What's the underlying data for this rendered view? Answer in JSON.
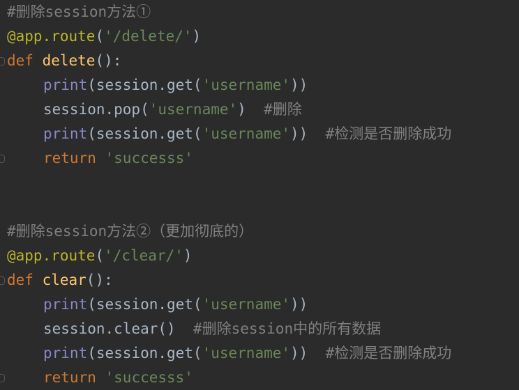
{
  "editor": {
    "background": "#2b2b2b",
    "colors": {
      "comment": "#808080",
      "decorator": "#bbb529",
      "keyword": "#cc7832",
      "function_name": "#ffc66d",
      "builtin": "#8888c6",
      "string": "#6a8759",
      "default": "#a9b7c6"
    },
    "lines": [
      {
        "indent": 0,
        "tokens": [
          {
            "type": "comment",
            "text": "#删除session方法①"
          }
        ]
      },
      {
        "indent": 0,
        "tokens": [
          {
            "type": "decorator",
            "text": "@app.route"
          },
          {
            "type": "default",
            "text": "("
          },
          {
            "type": "string",
            "text": "'/delete/'"
          },
          {
            "type": "default",
            "text": ")"
          }
        ]
      },
      {
        "indent": 0,
        "fold": true,
        "tokens": [
          {
            "type": "keyword",
            "text": "def "
          },
          {
            "type": "funcname",
            "text": "delete"
          },
          {
            "type": "default",
            "text": "():"
          }
        ]
      },
      {
        "indent": 1,
        "tokens": [
          {
            "type": "builtin",
            "text": "print"
          },
          {
            "type": "default",
            "text": "(session.get("
          },
          {
            "type": "string",
            "text": "'username'"
          },
          {
            "type": "default",
            "text": "))"
          }
        ]
      },
      {
        "indent": 1,
        "tokens": [
          {
            "type": "default",
            "text": "session.pop("
          },
          {
            "type": "string",
            "text": "'username'"
          },
          {
            "type": "default",
            "text": ")  "
          },
          {
            "type": "comment",
            "text": "#删除"
          }
        ]
      },
      {
        "indent": 1,
        "tokens": [
          {
            "type": "builtin",
            "text": "print"
          },
          {
            "type": "default",
            "text": "(session.get("
          },
          {
            "type": "string",
            "text": "'username'"
          },
          {
            "type": "default",
            "text": "))  "
          },
          {
            "type": "comment",
            "text": "#检测是否删除成功"
          }
        ]
      },
      {
        "indent": 1,
        "fold": true,
        "tokens": [
          {
            "type": "keyword",
            "text": "return "
          },
          {
            "type": "string",
            "text": "'successs'"
          }
        ]
      },
      {
        "indent": 0,
        "tokens": []
      },
      {
        "indent": 0,
        "tokens": []
      },
      {
        "indent": 0,
        "tokens": [
          {
            "type": "comment",
            "text": "#删除session方法②（更加彻底的）"
          }
        ]
      },
      {
        "indent": 0,
        "tokens": [
          {
            "type": "decorator",
            "text": "@app.route"
          },
          {
            "type": "default",
            "text": "("
          },
          {
            "type": "string",
            "text": "'/clear/'"
          },
          {
            "type": "default",
            "text": ")"
          }
        ]
      },
      {
        "indent": 0,
        "fold": true,
        "tokens": [
          {
            "type": "keyword",
            "text": "def "
          },
          {
            "type": "funcname",
            "text": "clear"
          },
          {
            "type": "default",
            "text": "():"
          }
        ]
      },
      {
        "indent": 1,
        "tokens": [
          {
            "type": "builtin",
            "text": "print"
          },
          {
            "type": "default",
            "text": "(session.get("
          },
          {
            "type": "string",
            "text": "'username'"
          },
          {
            "type": "default",
            "text": "))"
          }
        ]
      },
      {
        "indent": 1,
        "tokens": [
          {
            "type": "default",
            "text": "session.clear()  "
          },
          {
            "type": "comment",
            "text": "#删除session中的所有数据"
          }
        ]
      },
      {
        "indent": 1,
        "tokens": [
          {
            "type": "builtin",
            "text": "print"
          },
          {
            "type": "default",
            "text": "(session.get("
          },
          {
            "type": "string",
            "text": "'username'"
          },
          {
            "type": "default",
            "text": "))  "
          },
          {
            "type": "comment",
            "text": "#检测是否删除成功"
          }
        ]
      },
      {
        "indent": 1,
        "fold": true,
        "tokens": [
          {
            "type": "keyword",
            "text": "return "
          },
          {
            "type": "string",
            "text": "'successs'"
          }
        ]
      }
    ]
  }
}
